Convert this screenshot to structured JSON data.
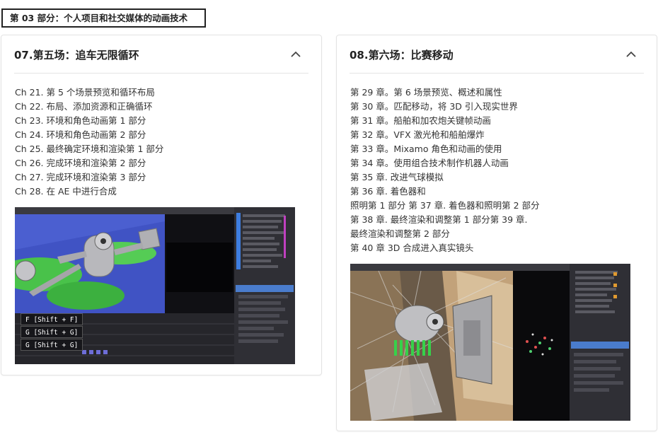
{
  "section": {
    "label": "第 03 部分：个人项目和社交媒体的动画技术"
  },
  "cards": [
    {
      "title": "07.第五场：追车无限循环",
      "chapters": [
        "Ch 21. 第 5 个场景预览和循环布局",
        "Ch 22. 布局、添加资源和正确循环",
        "Ch 23. 环境和角色动画第 1 部分",
        "Ch 24. 环境和角色动画第 2 部分",
        "Ch 25. 最终确定环境和渲染第 1 部分",
        "Ch 26. 完成环境和渲染第 2 部分",
        "Ch 27. 完成环境和渲染第 3 部分",
        "Ch 28. 在 AE 中进行合成"
      ],
      "shortcuts": [
        "F [Shift + F]",
        "G [Shift + G]",
        "G [Shift + G]"
      ]
    },
    {
      "title": "08.第六场：比赛移动",
      "chapters": [
        "第 29 章。第 6 场景预览、概述和属性",
        "第 30 章。匹配移动，将 3D 引入现实世界",
        "第 31 章。船舶和加农炮关键帧动画",
        "第 32 章。VFX 激光枪和船舶爆炸",
        "第 33 章。Mixamo 角色和动画的使用",
        "第 34 章。使用组合技术制作机器人动画",
        "第 35 章. 改进气球模拟",
        "第 36 章. 着色器和",
        "照明第 1 部分 第 37 章. 着色器和照明第 2 部分",
        "第 38 章. 最终渲染和调整第 1 部分第 39 章.",
        "最终渲染和调整第 2 部分",
        "第 40 章 3D 合成进入真实镜头"
      ]
    }
  ]
}
